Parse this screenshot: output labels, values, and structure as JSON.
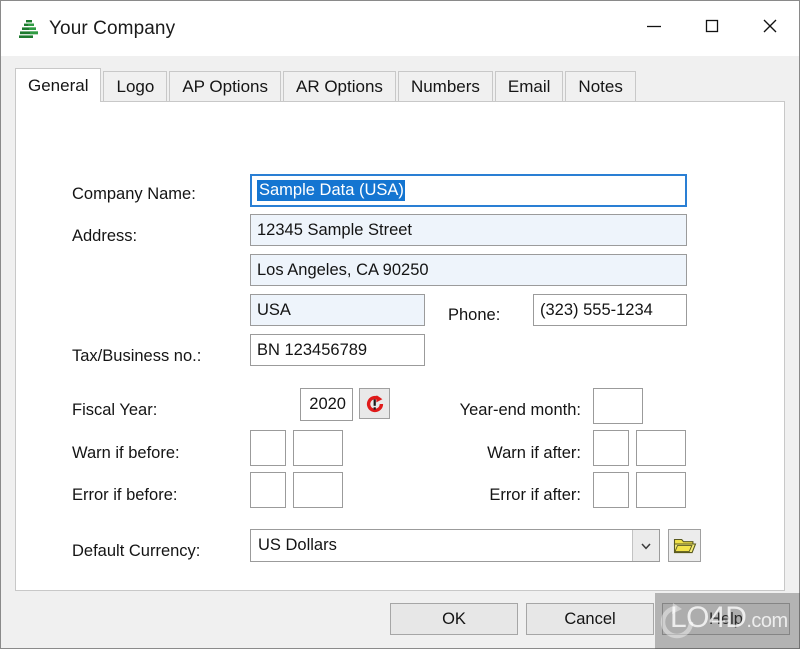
{
  "window": {
    "title": "Your Company",
    "app_icon": "green-pyramid-icon",
    "controls": [
      {
        "name": "minimize-button",
        "glyph": "minimize-icon"
      },
      {
        "name": "maximize-button",
        "glyph": "maximize-icon"
      },
      {
        "name": "close-button",
        "glyph": "close-icon"
      }
    ]
  },
  "tabs": [
    {
      "label": "General",
      "active": true
    },
    {
      "label": "Logo",
      "active": false
    },
    {
      "label": "AP Options",
      "active": false
    },
    {
      "label": "AR Options",
      "active": false
    },
    {
      "label": "Numbers",
      "active": false
    },
    {
      "label": "Email",
      "active": false
    },
    {
      "label": "Notes",
      "active": false
    }
  ],
  "form": {
    "company_name_label": "Company Name:",
    "company_name_value": "Sample Data (USA)",
    "address_label": "Address:",
    "address_line1": "12345 Sample Street",
    "address_line2": "Los Angeles, CA 90250",
    "address_line3": "USA",
    "phone_label": "Phone:",
    "phone_value": "(323) 555-1234",
    "tax_label": "Tax/Business no.:",
    "tax_value": "BN 123456789",
    "fiscal_year_label": "Fiscal Year:",
    "fiscal_year_value": "2020",
    "fiscal_year_refresh_icon": "red-refresh-icon",
    "year_end_month_label": "Year-end month:",
    "year_end_month_value": "",
    "warn_if_before_label": "Warn if before:",
    "warn_if_before_a": "",
    "warn_if_before_b": "",
    "error_if_before_label": "Error if before:",
    "error_if_before_a": "",
    "error_if_before_b": "",
    "warn_if_after_label": "Warn if after:",
    "warn_if_after_a": "",
    "warn_if_after_b": "",
    "error_if_after_label": "Error if after:",
    "error_if_after_a": "",
    "error_if_after_b": "",
    "default_currency_label": "Default Currency:",
    "default_currency_value": "US Dollars",
    "currency_browse_icon": "open-folder-icon",
    "dropdown_icon": "chevron-down-icon"
  },
  "footer": {
    "ok_label": "OK",
    "cancel_label": "Cancel",
    "help_label": "Help"
  },
  "watermark": {
    "text_main": "LO4D",
    "text_suffix": ".com"
  },
  "colors": {
    "selection_blue": "#1475d1",
    "focus_border": "#2a7fd4",
    "tinted_field": "#eef4fb",
    "icon_green": "#1d7a2e",
    "refresh_red": "#e01b1b",
    "folder_yellow": "#f2e34a",
    "chrome": "#f0f0f0"
  }
}
